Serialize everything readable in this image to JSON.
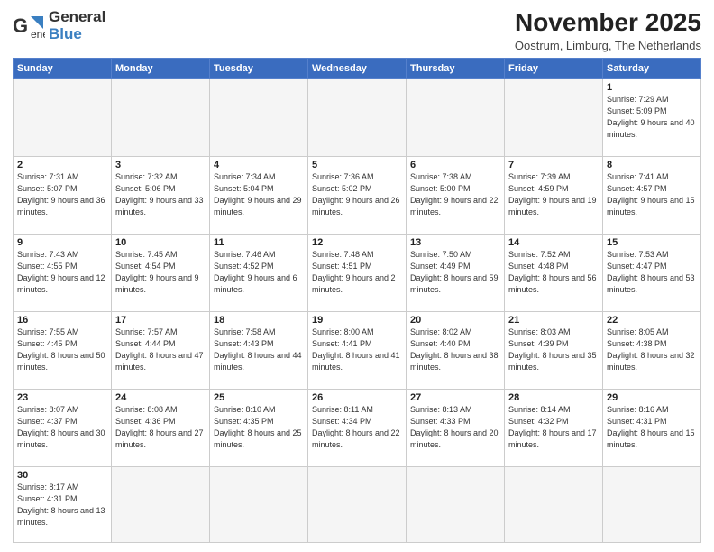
{
  "logo": {
    "line1": "General",
    "line2": "Blue"
  },
  "title": "November 2025",
  "subtitle": "Oostrum, Limburg, The Netherlands",
  "days_header": [
    "Sunday",
    "Monday",
    "Tuesday",
    "Wednesday",
    "Thursday",
    "Friday",
    "Saturday"
  ],
  "weeks": [
    [
      {
        "day": "",
        "info": ""
      },
      {
        "day": "",
        "info": ""
      },
      {
        "day": "",
        "info": ""
      },
      {
        "day": "",
        "info": ""
      },
      {
        "day": "",
        "info": ""
      },
      {
        "day": "",
        "info": ""
      },
      {
        "day": "1",
        "info": "Sunrise: 7:29 AM\nSunset: 5:09 PM\nDaylight: 9 hours and 40 minutes."
      }
    ],
    [
      {
        "day": "2",
        "info": "Sunrise: 7:31 AM\nSunset: 5:07 PM\nDaylight: 9 hours and 36 minutes."
      },
      {
        "day": "3",
        "info": "Sunrise: 7:32 AM\nSunset: 5:06 PM\nDaylight: 9 hours and 33 minutes."
      },
      {
        "day": "4",
        "info": "Sunrise: 7:34 AM\nSunset: 5:04 PM\nDaylight: 9 hours and 29 minutes."
      },
      {
        "day": "5",
        "info": "Sunrise: 7:36 AM\nSunset: 5:02 PM\nDaylight: 9 hours and 26 minutes."
      },
      {
        "day": "6",
        "info": "Sunrise: 7:38 AM\nSunset: 5:00 PM\nDaylight: 9 hours and 22 minutes."
      },
      {
        "day": "7",
        "info": "Sunrise: 7:39 AM\nSunset: 4:59 PM\nDaylight: 9 hours and 19 minutes."
      },
      {
        "day": "8",
        "info": "Sunrise: 7:41 AM\nSunset: 4:57 PM\nDaylight: 9 hours and 15 minutes."
      }
    ],
    [
      {
        "day": "9",
        "info": "Sunrise: 7:43 AM\nSunset: 4:55 PM\nDaylight: 9 hours and 12 minutes."
      },
      {
        "day": "10",
        "info": "Sunrise: 7:45 AM\nSunset: 4:54 PM\nDaylight: 9 hours and 9 minutes."
      },
      {
        "day": "11",
        "info": "Sunrise: 7:46 AM\nSunset: 4:52 PM\nDaylight: 9 hours and 6 minutes."
      },
      {
        "day": "12",
        "info": "Sunrise: 7:48 AM\nSunset: 4:51 PM\nDaylight: 9 hours and 2 minutes."
      },
      {
        "day": "13",
        "info": "Sunrise: 7:50 AM\nSunset: 4:49 PM\nDaylight: 8 hours and 59 minutes."
      },
      {
        "day": "14",
        "info": "Sunrise: 7:52 AM\nSunset: 4:48 PM\nDaylight: 8 hours and 56 minutes."
      },
      {
        "day": "15",
        "info": "Sunrise: 7:53 AM\nSunset: 4:47 PM\nDaylight: 8 hours and 53 minutes."
      }
    ],
    [
      {
        "day": "16",
        "info": "Sunrise: 7:55 AM\nSunset: 4:45 PM\nDaylight: 8 hours and 50 minutes."
      },
      {
        "day": "17",
        "info": "Sunrise: 7:57 AM\nSunset: 4:44 PM\nDaylight: 8 hours and 47 minutes."
      },
      {
        "day": "18",
        "info": "Sunrise: 7:58 AM\nSunset: 4:43 PM\nDaylight: 8 hours and 44 minutes."
      },
      {
        "day": "19",
        "info": "Sunrise: 8:00 AM\nSunset: 4:41 PM\nDaylight: 8 hours and 41 minutes."
      },
      {
        "day": "20",
        "info": "Sunrise: 8:02 AM\nSunset: 4:40 PM\nDaylight: 8 hours and 38 minutes."
      },
      {
        "day": "21",
        "info": "Sunrise: 8:03 AM\nSunset: 4:39 PM\nDaylight: 8 hours and 35 minutes."
      },
      {
        "day": "22",
        "info": "Sunrise: 8:05 AM\nSunset: 4:38 PM\nDaylight: 8 hours and 32 minutes."
      }
    ],
    [
      {
        "day": "23",
        "info": "Sunrise: 8:07 AM\nSunset: 4:37 PM\nDaylight: 8 hours and 30 minutes."
      },
      {
        "day": "24",
        "info": "Sunrise: 8:08 AM\nSunset: 4:36 PM\nDaylight: 8 hours and 27 minutes."
      },
      {
        "day": "25",
        "info": "Sunrise: 8:10 AM\nSunset: 4:35 PM\nDaylight: 8 hours and 25 minutes."
      },
      {
        "day": "26",
        "info": "Sunrise: 8:11 AM\nSunset: 4:34 PM\nDaylight: 8 hours and 22 minutes."
      },
      {
        "day": "27",
        "info": "Sunrise: 8:13 AM\nSunset: 4:33 PM\nDaylight: 8 hours and 20 minutes."
      },
      {
        "day": "28",
        "info": "Sunrise: 8:14 AM\nSunset: 4:32 PM\nDaylight: 8 hours and 17 minutes."
      },
      {
        "day": "29",
        "info": "Sunrise: 8:16 AM\nSunset: 4:31 PM\nDaylight: 8 hours and 15 minutes."
      }
    ],
    [
      {
        "day": "30",
        "info": "Sunrise: 8:17 AM\nSunset: 4:31 PM\nDaylight: 8 hours and 13 minutes."
      },
      {
        "day": "",
        "info": ""
      },
      {
        "day": "",
        "info": ""
      },
      {
        "day": "",
        "info": ""
      },
      {
        "day": "",
        "info": ""
      },
      {
        "day": "",
        "info": ""
      },
      {
        "day": "",
        "info": ""
      }
    ]
  ]
}
